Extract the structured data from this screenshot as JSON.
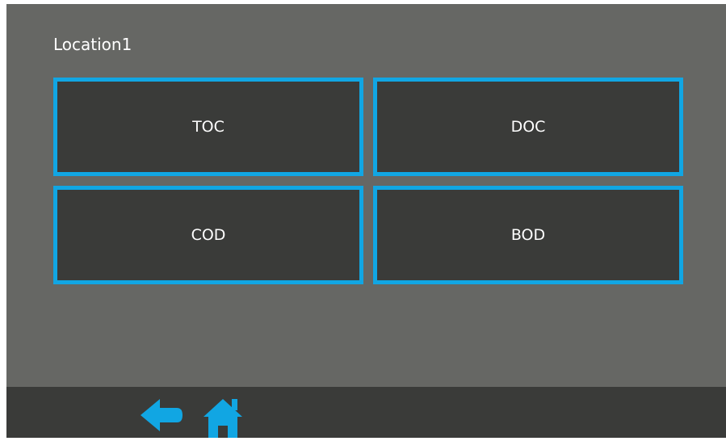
{
  "header": {
    "title": "Location1"
  },
  "tiles": [
    {
      "label": "TOC"
    },
    {
      "label": "DOC"
    },
    {
      "label": "COD"
    },
    {
      "label": "BOD"
    }
  ],
  "footer": {
    "back_icon": "arrow-left-icon",
    "home_icon": "home-icon"
  },
  "colors": {
    "background": "#666764",
    "tile_fill": "#3a3b39",
    "accent": "#11a6e3",
    "footer": "#3a3b39",
    "text": "#ffffff"
  }
}
